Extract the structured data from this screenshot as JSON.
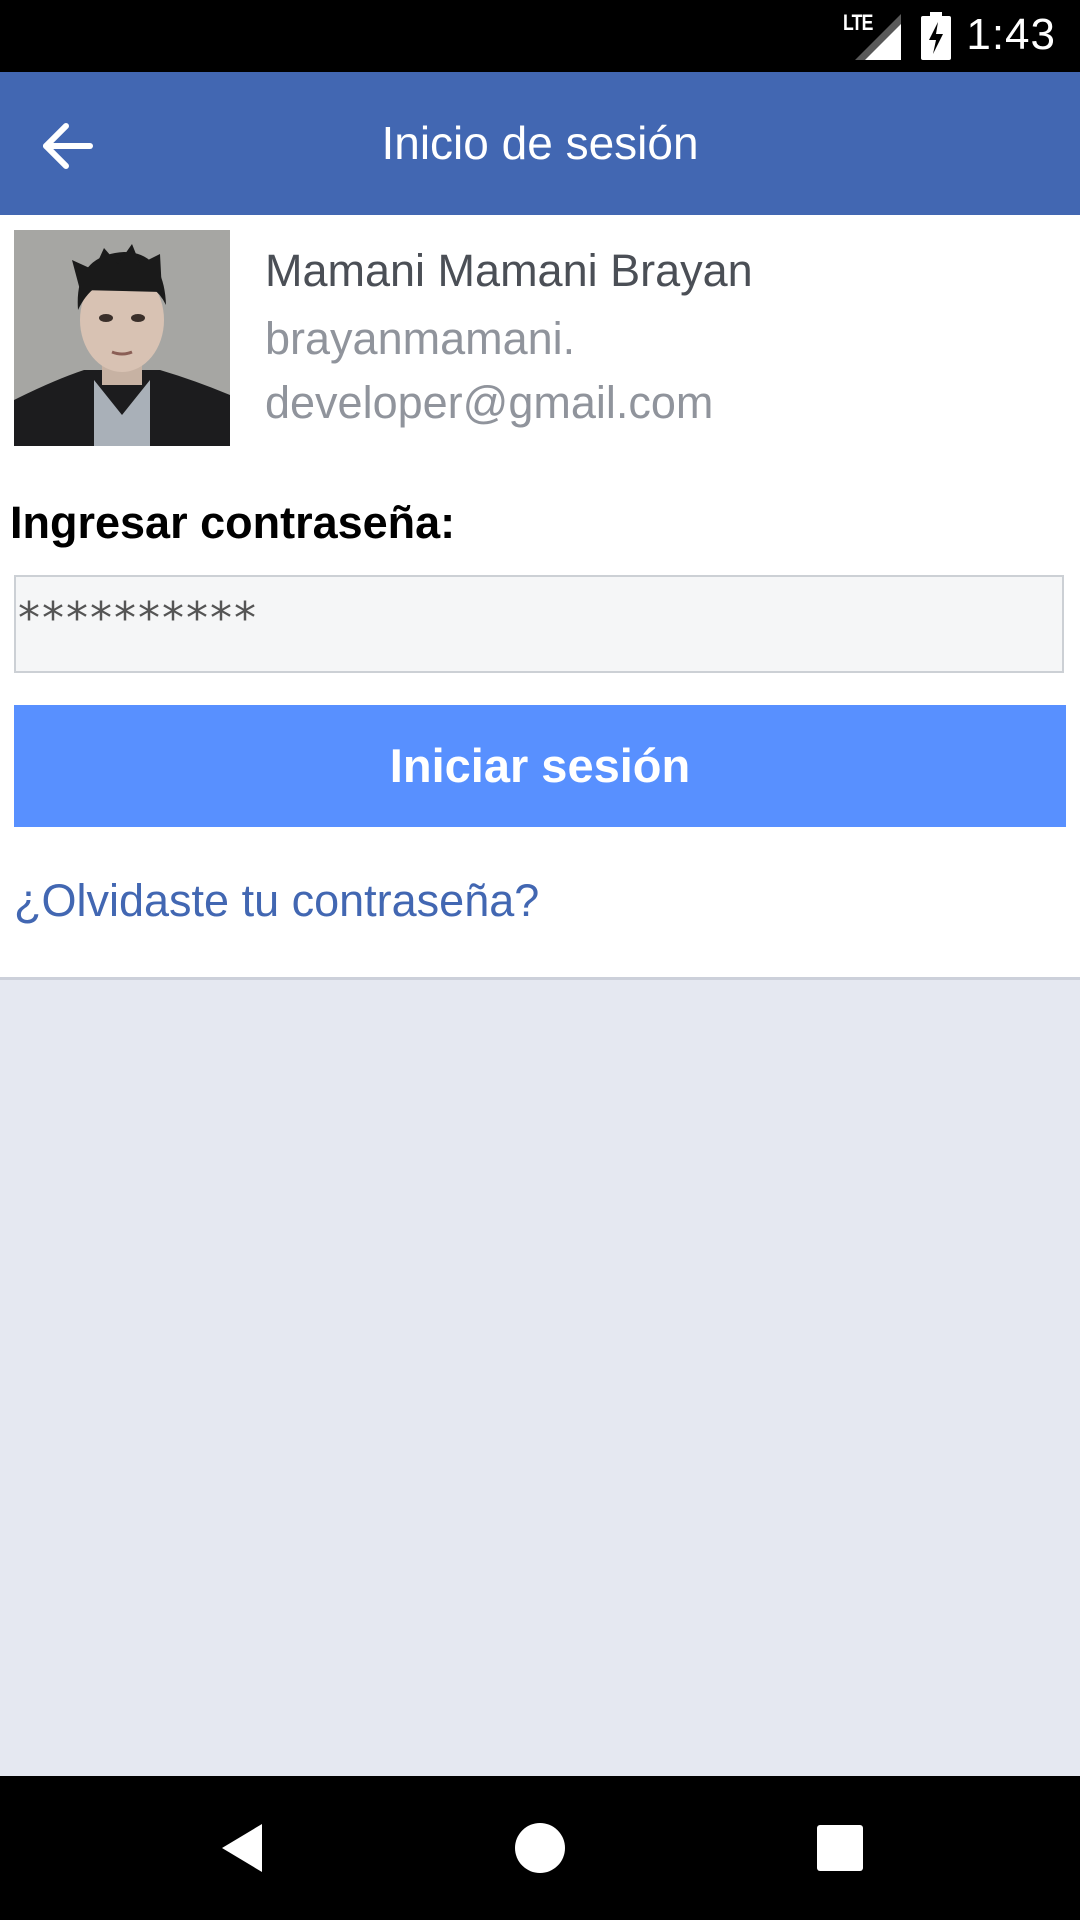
{
  "status_bar": {
    "network": "LTE",
    "time": "1:43",
    "icons": [
      "signal-icon",
      "battery-charging-icon"
    ]
  },
  "app_bar": {
    "title": "Inicio de sesión",
    "back_icon": "arrow-left-icon"
  },
  "account": {
    "name": "Mamani Mamani Brayan",
    "email_line1": "brayanmamani.",
    "email_line2": "developer@gmail.com"
  },
  "form": {
    "password_label": "Ingresar contraseña:",
    "password_value": "**********",
    "login_button": "Iniciar sesión",
    "forgot_link": "¿Olvidaste tu contraseña?"
  },
  "nav_bar": {
    "icons": [
      "back-triangle-icon",
      "home-circle-icon",
      "recents-square-icon"
    ]
  },
  "colors": {
    "app_bar": "#4267b2",
    "button": "#5890ff",
    "link": "#4267b2",
    "background": "#e5e8f1"
  }
}
